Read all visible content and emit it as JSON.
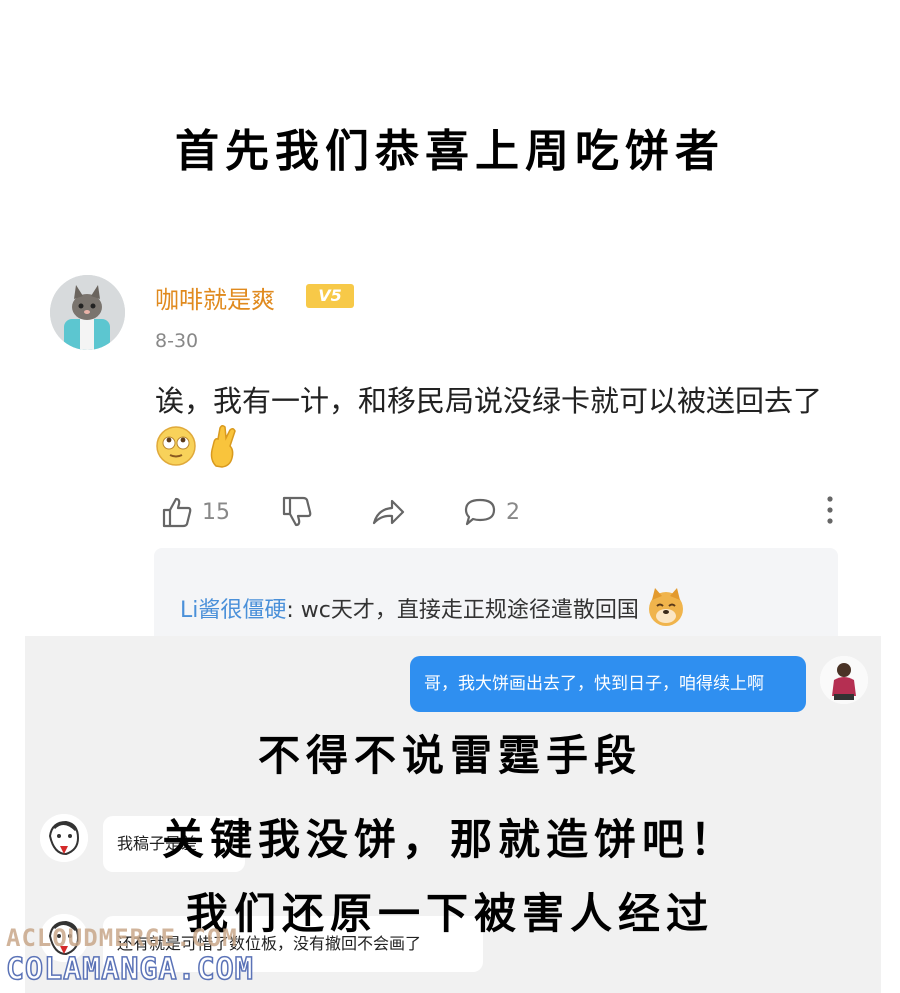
{
  "captions": {
    "line1": "首先我们恭喜上周吃饼者",
    "line2": "不得不说雷霆手段",
    "line3": "关键我没饼，那就造饼吧！",
    "line4": "我们还原一下被害人经过"
  },
  "comment": {
    "username": "咖啡就是爽",
    "badge": "V5",
    "date": "8-30",
    "text": "诶，我有一计，和移民局说没绿卡就可以被送回去了",
    "like_count": "15",
    "reply_count": "2"
  },
  "reply": {
    "user": "Li酱很僵硬",
    "text": ": wc天才，直接走正规途径遣散回国"
  },
  "chat": {
    "me_message": "哥，我大饼画出去了，快到日子，咱得续上啊",
    "other_message_1": "我稿子是差",
    "other_message_2": "还有就是可惜了数位板，没有撤回不会画了"
  },
  "watermark": {
    "line1": "ACLOUDMERGE.COM",
    "line2": "COLAMANGA.COM"
  },
  "colors": {
    "username": "#e08a1e",
    "reply_user": "#4a90d9",
    "bubble_me": "#2f8ff0"
  }
}
